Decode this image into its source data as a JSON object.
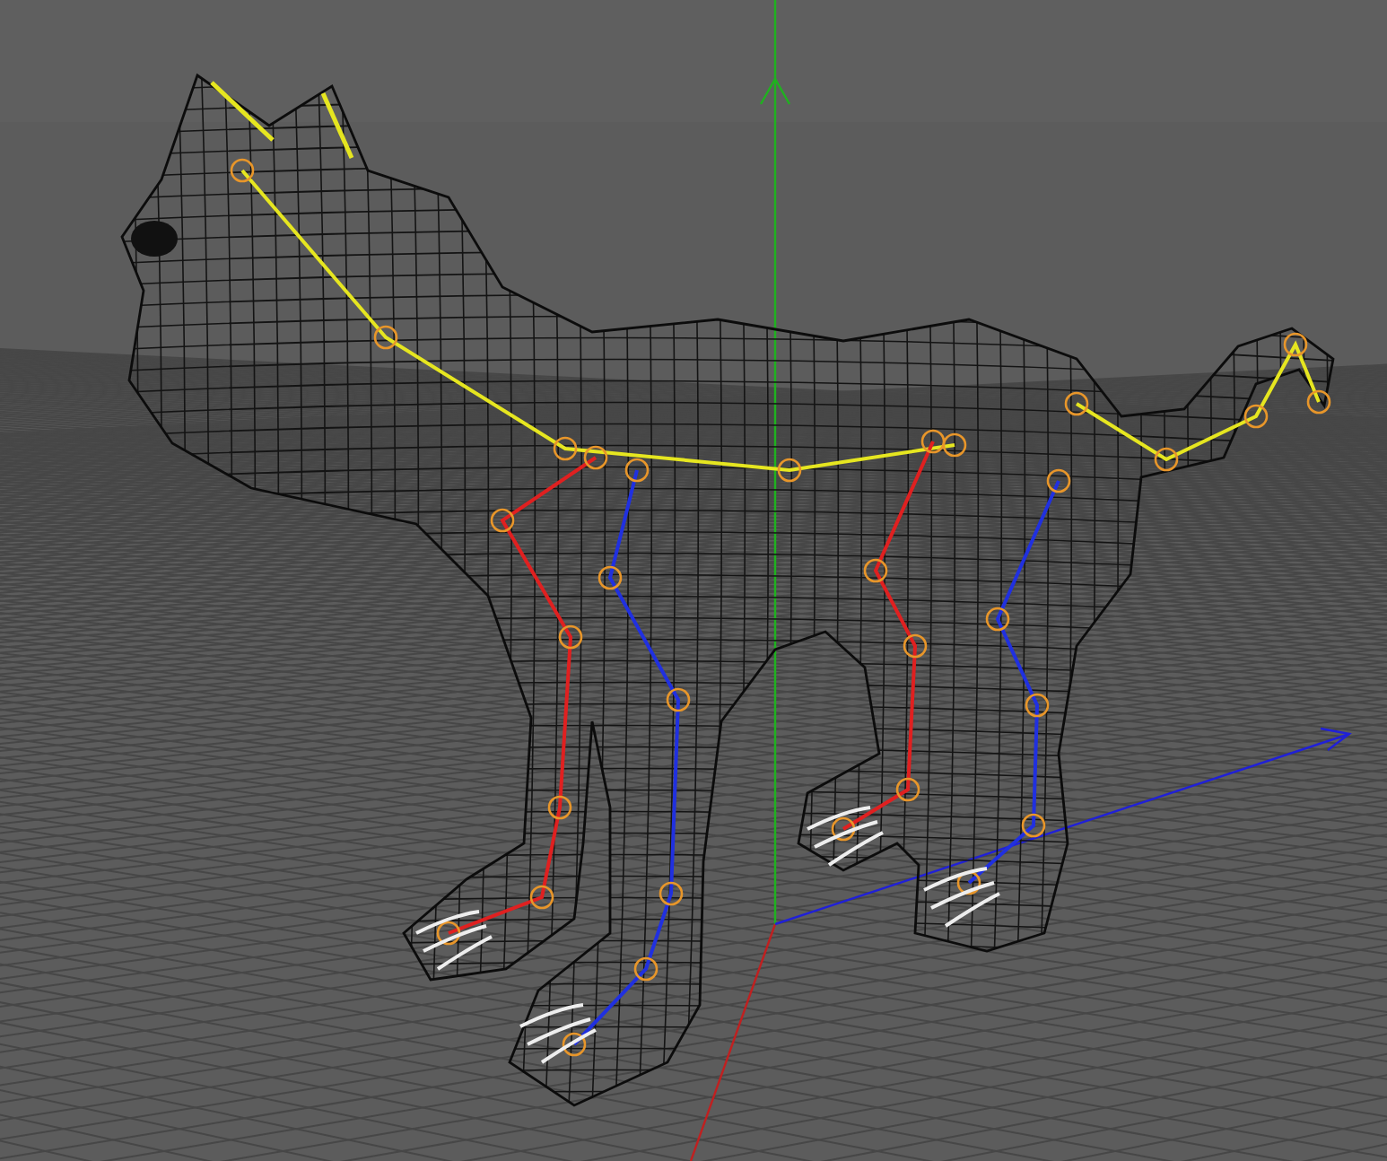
{
  "viewport": {
    "grid": true,
    "axes": true,
    "wireframe": true,
    "skeleton": true
  }
}
